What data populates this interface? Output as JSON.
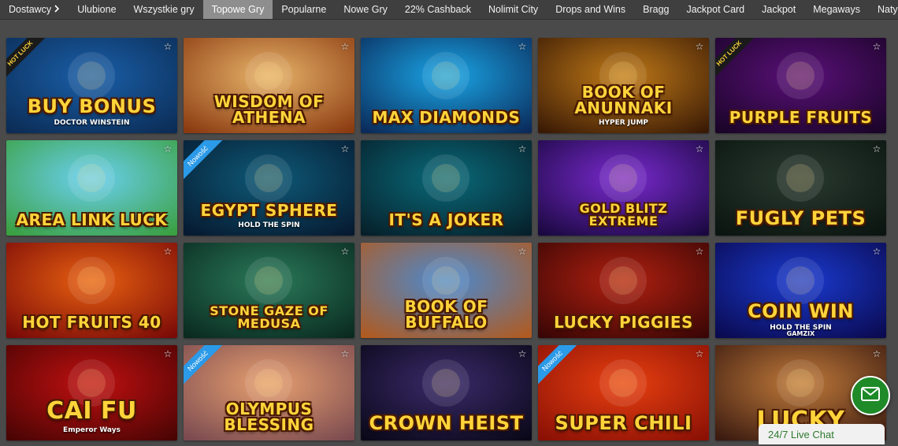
{
  "nav": {
    "providers_label": "Dostawcy",
    "items": [
      "Ulubione",
      "Wszystkie gry",
      "Topowe Gry",
      "Popularne",
      "Nowe Gry",
      "22% Cashback",
      "Nolimit City",
      "Drops and Wins",
      "Bragg",
      "Jackpot Card",
      "Jackpot",
      "Megaways",
      "Natychmiastowa w"
    ],
    "active": "Topowe Gry"
  },
  "games": [
    {
      "title": "BUY BONUS",
      "subtitle": "DOCTOR WINSTEIN",
      "badge": "HOT LUCK",
      "colors": [
        "#1a5fa8",
        "#0b2c55"
      ]
    },
    {
      "title": "WISDOM OF ATHENA",
      "subtitle": "",
      "badge": "",
      "colors": [
        "#e8b46a",
        "#8a3a10"
      ]
    },
    {
      "title": "MAX DIAMONDS",
      "subtitle": "",
      "badge": "",
      "colors": [
        "#1aa6e6",
        "#0a2a5a"
      ]
    },
    {
      "title": "BOOK OF ANUNNAKI",
      "subtitle": "HYPER JUMP",
      "badge": "",
      "colors": [
        "#c07a18",
        "#3a1a05"
      ]
    },
    {
      "title": "PURPLE FRUITS",
      "subtitle": "",
      "badge": "HOT LUCK",
      "colors": [
        "#5a1078",
        "#1a0428"
      ]
    },
    {
      "title": "AREA LINK LUCK",
      "subtitle": "",
      "badge": "",
      "colors": [
        "#6ad0f0",
        "#3aa040"
      ]
    },
    {
      "title": "EGYPT SPHERE",
      "subtitle": "HOLD THE SPIN",
      "badge": "Nowość",
      "colors": [
        "#0e5a78",
        "#061a30"
      ]
    },
    {
      "title": "IT'S A JOKER",
      "subtitle": "",
      "badge": "",
      "colors": [
        "#0a6a7a",
        "#06202a"
      ]
    },
    {
      "title": "GOLD BLITZ EXTREME",
      "subtitle": "",
      "badge": "",
      "colors": [
        "#7a2ad0",
        "#1a0840"
      ]
    },
    {
      "title": "FUGLY PETS",
      "subtitle": "",
      "badge": "",
      "colors": [
        "#2a3a30",
        "#0a1410"
      ]
    },
    {
      "title": "HOT FRUITS 40",
      "subtitle": "",
      "badge": "",
      "colors": [
        "#e86010",
        "#7a0a08"
      ]
    },
    {
      "title": "STONE GAZE OF MEDUSA",
      "subtitle": "",
      "badge": "",
      "colors": [
        "#2a7a5a",
        "#0a2a20"
      ]
    },
    {
      "title": "BOOK OF BUFFALO",
      "subtitle": "",
      "badge": "",
      "colors": [
        "#4a8ad0",
        "#b05a20"
      ]
    },
    {
      "title": "LUCKY PIGGIES",
      "subtitle": "",
      "badge": "",
      "colors": [
        "#b02010",
        "#3a0605"
      ]
    },
    {
      "title": "COIN WIN",
      "subtitle": "HOLD THE SPIN",
      "badge": "",
      "colors": [
        "#1a3ad0",
        "#0a0a50"
      ]
    },
    {
      "title": "CAI FU",
      "subtitle": "Emperor Ways",
      "badge": "",
      "colors": [
        "#c01010",
        "#4a0404"
      ]
    },
    {
      "title": "OLYMPUS BLESSING",
      "subtitle": "",
      "badge": "Nowość",
      "colors": [
        "#e8a070",
        "#7a4a50"
      ]
    },
    {
      "title": "CROWN HEIST",
      "subtitle": "",
      "badge": "",
      "colors": [
        "#3a2a6a",
        "#0a0818"
      ]
    },
    {
      "title": "SUPER CHILI",
      "subtitle": "",
      "badge": "Nowość",
      "colors": [
        "#e84010",
        "#8a1005"
      ]
    },
    {
      "title": "LUCKY",
      "subtitle": "",
      "badge": "",
      "colors": [
        "#c07a3a",
        "#3a1a10"
      ]
    }
  ],
  "provider_tag": "GAMZIX",
  "chat": {
    "label": "24/7 Live Chat",
    "icon": "envelope-icon",
    "color": "#1e8a28"
  }
}
